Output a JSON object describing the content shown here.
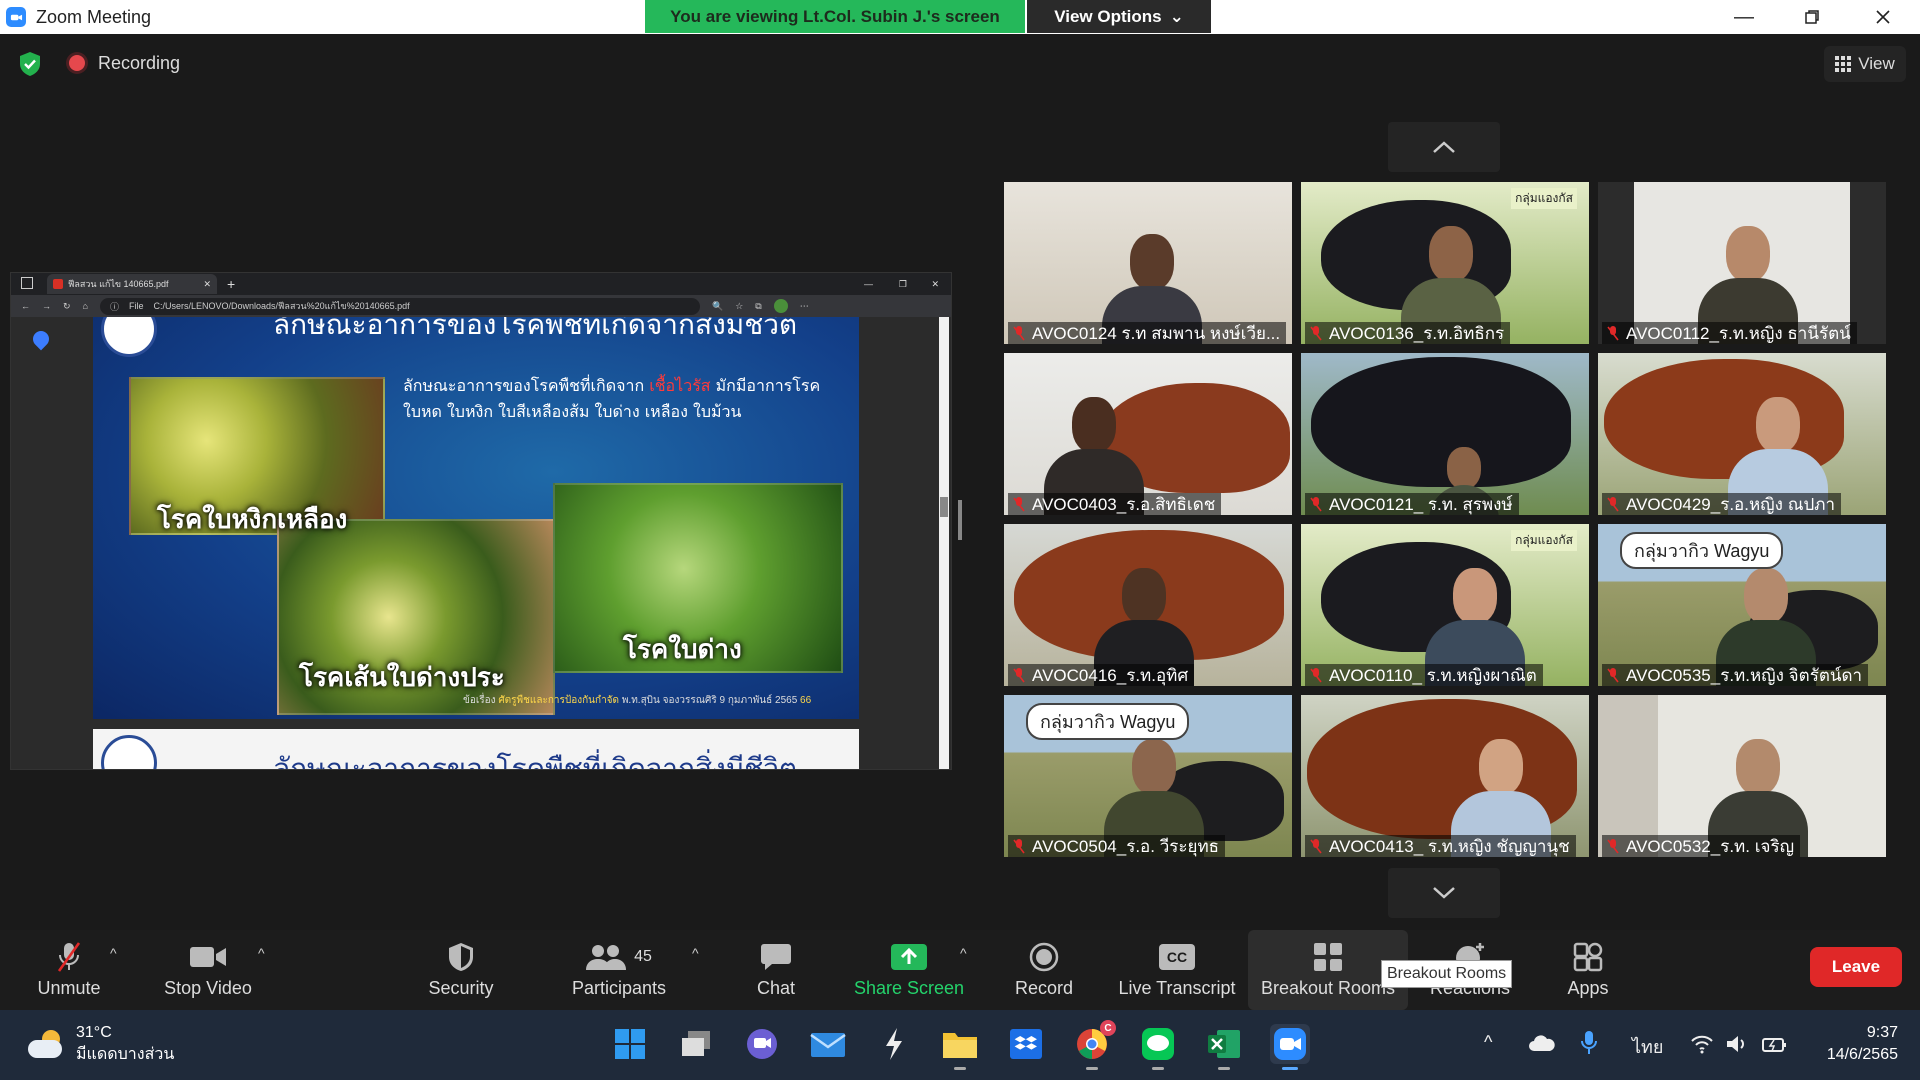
{
  "window": {
    "title": "Zoom Meeting"
  },
  "banner": {
    "viewing": "You are viewing Lt.Col. Subin J.'s screen",
    "view_options": "View Options"
  },
  "meeting": {
    "recording_label": "Recording",
    "view_label": "View"
  },
  "shared_screen": {
    "tab_title": "ฟีลสวน แก้ไข 140665.pdf",
    "url_prefix": "File",
    "url": "C:/Users/LENOVO/Downloads/ฟีลสวน%20แก้ไข%20140665.pdf",
    "slide": {
      "title": "ลักษณะอาการของโรคพืชที่เกิดจากสิ่งมีชีวิต",
      "desc_before": "ลักษณะอาการของโรคพืชที่เกิดจาก ",
      "desc_virus": "เชื้อไวรัส",
      "desc_after": " มักมีอาการโรค ใบหด ใบหงิก ใบสีเหลืองส้ม ใบด่าง เหลือง ใบม้วน",
      "label1": "โรคใบหงิกเหลือง",
      "label2": "โรคเส้นใบด่างประ",
      "label3": "โรคใบด่าง",
      "footer_prefix": "ข้อเรื่อง",
      "footer_highlight": "ศัตรูพืชและการป้องกันกำจัด",
      "footer_author": "พ.ท.สุบิน จองวรรณศิริ 9 กุมภาพันธ์ 2565",
      "page": "66"
    },
    "slide2": {
      "title": "ลักษณะอาการของโรคพืชที่เกิดจากสิ่งมีชีวิต"
    }
  },
  "participants": [
    {
      "name": "AVOC0124 ร.ท สมพาน หงษ์เวีย..."
    },
    {
      "name": "AVOC0136_ร.ท.อิทธิกร",
      "sign": "กลุ่มแองกัส"
    },
    {
      "name": "AVOC0112_ร.ท.หญิง ธานีรัตน์"
    },
    {
      "name": "AVOC0403_ร.อ.สิทธิเดช"
    },
    {
      "name": "AVOC0121_ ร.ท. สุรพงษ์"
    },
    {
      "name": "AVOC0429_ร.อ.หญิง ณปภา"
    },
    {
      "name": "AVOC0416_ร.ท.อุทิศ"
    },
    {
      "name": "AVOC0110_ ร.ท.หญิงผาณิต",
      "sign": "กลุ่มแองกัส"
    },
    {
      "name": "AVOC0535_ร.ท.หญิง จิตรัตน์ดา",
      "banner": "กลุ่มวากิว Wagyu"
    },
    {
      "name": "AVOC0504_ร.อ. วีระยุทธ",
      "banner": "กลุ่มวากิว Wagyu"
    },
    {
      "name": "AVOC0413_ ร.ท.หญิง ชัญญานุช"
    },
    {
      "name": "AVOC0532_ร.ท. เจริญ"
    }
  ],
  "toolbar": {
    "unmute": "Unmute",
    "stop_video": "Stop Video",
    "security": "Security",
    "participants": "Participants",
    "participants_count": "45",
    "chat": "Chat",
    "share_screen": "Share Screen",
    "record": "Record",
    "live_transcript": "Live Transcript",
    "cc": "CC",
    "breakout_rooms": "Breakout Rooms",
    "reactions": "Reactions",
    "apps": "Apps",
    "leave": "Leave",
    "tooltip": "Breakout Rooms"
  },
  "taskbar": {
    "temp": "31°C",
    "weather": "มีแดดบางส่วน",
    "lang": "ไทย",
    "time": "9:37",
    "date": "14/6/2565",
    "chrome_badge": "C"
  },
  "colors": {
    "accent": "#2d8cff",
    "green": "#25b85a",
    "leave": "#e02828"
  }
}
